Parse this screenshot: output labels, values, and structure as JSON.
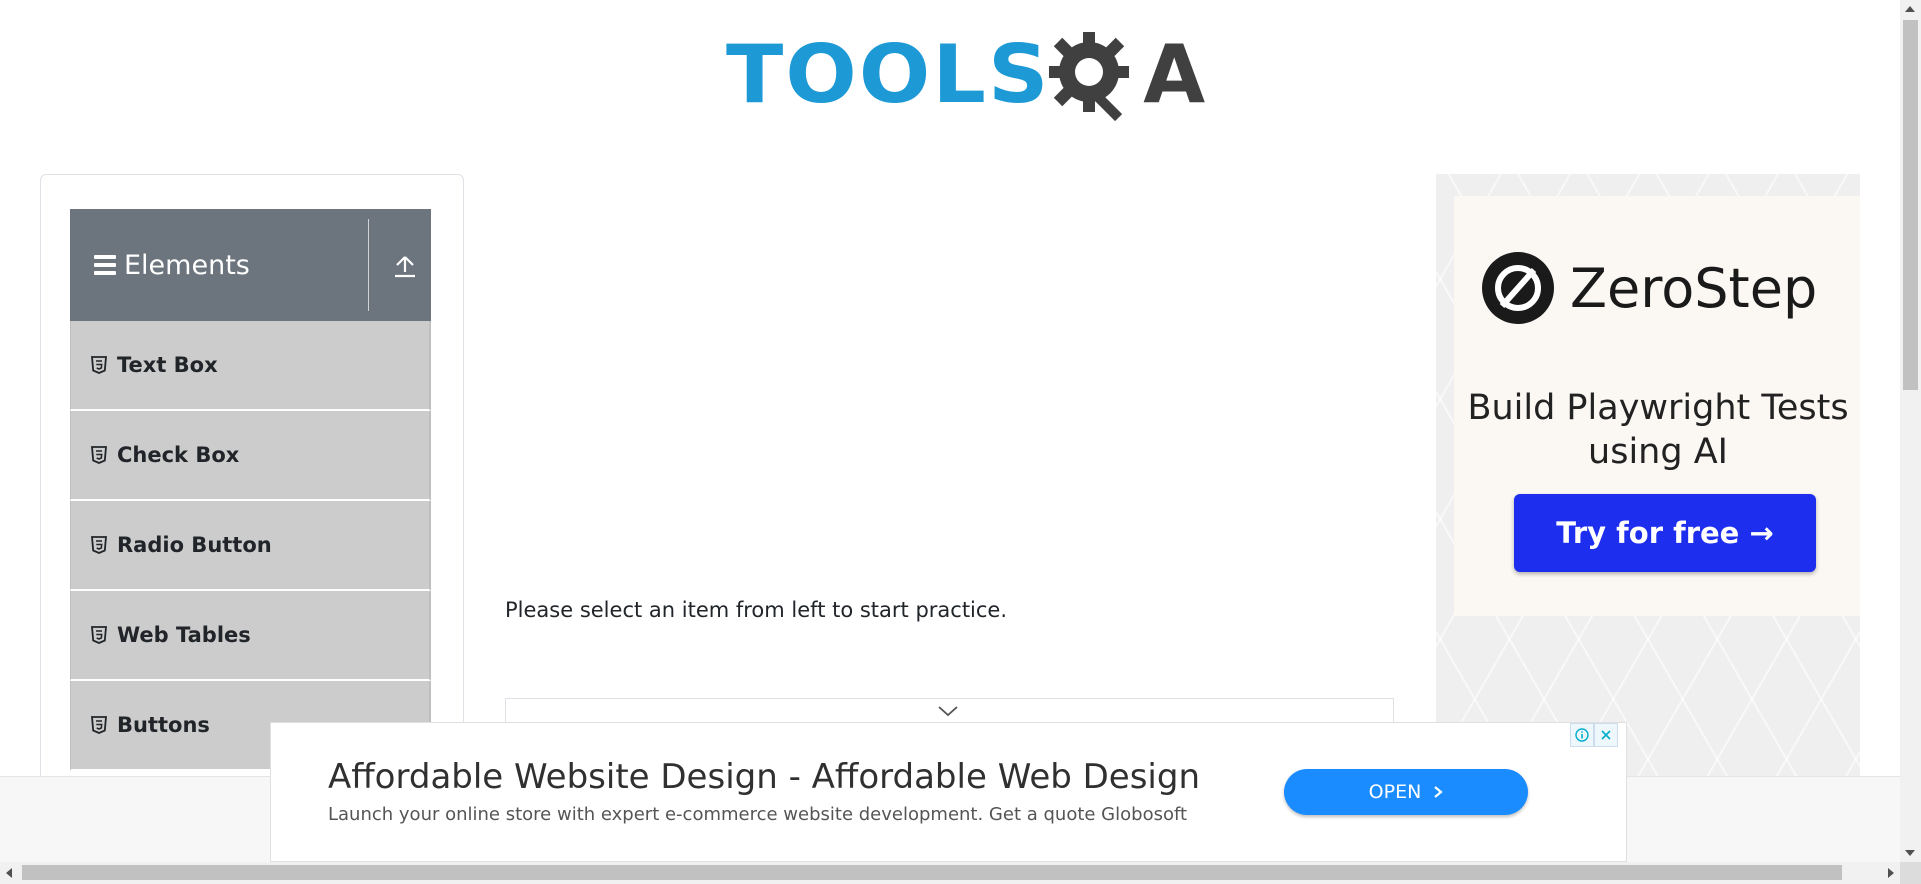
{
  "header": {
    "logo_text_left": "TOOLS",
    "logo_text_right": "A",
    "logo_icon": "gear-magnifier-icon"
  },
  "sidebar": {
    "group_title": "Elements",
    "group_icon": "hamburger-icon",
    "collapse_icon": "upload-arrow-icon",
    "items": [
      {
        "label": "Text Box",
        "icon": "html5-icon"
      },
      {
        "label": "Check Box",
        "icon": "html5-icon"
      },
      {
        "label": "Radio Button",
        "icon": "html5-icon"
      },
      {
        "label": "Web Tables",
        "icon": "html5-icon"
      },
      {
        "label": "Buttons",
        "icon": "html5-icon"
      }
    ]
  },
  "main": {
    "prompt": "Please select an item from left to start practice."
  },
  "right_ad": {
    "brand": "ZeroStep",
    "headline": "Build Playwright Tests using AI",
    "cta": "Try for free →",
    "cta_color": "#1d2eee"
  },
  "banner_ad": {
    "headline": "Affordable Website Design - Affordable Web Design",
    "description": "Launch your online store with expert e-commerce website development. Get a quote Globosoft",
    "button": "OPEN",
    "button_color": "#1a8cff"
  },
  "colors": {
    "logo_blue": "#1d9ad6",
    "logo_dark": "#404040",
    "group_header_bg": "#6c757d",
    "menu_item_bg": "#cccccc"
  }
}
